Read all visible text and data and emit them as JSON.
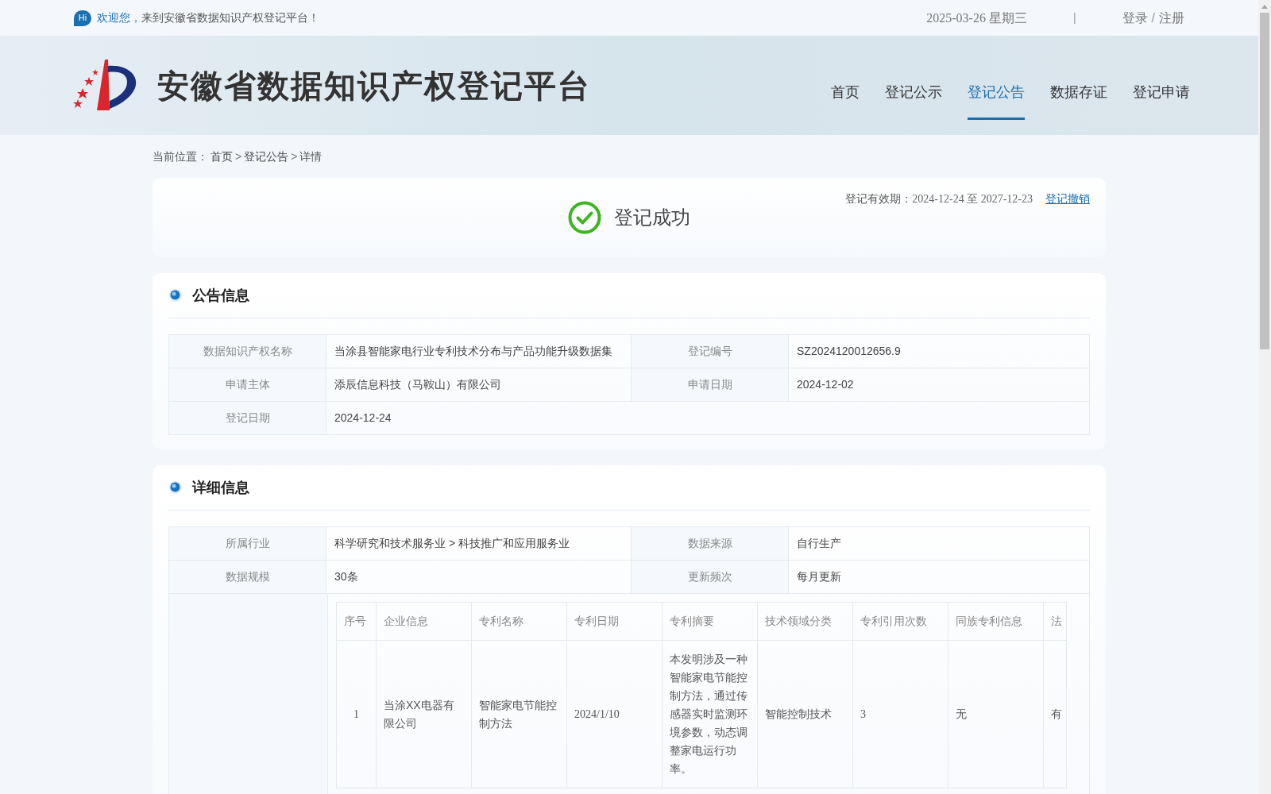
{
  "top_bar": {
    "hi_badge": "Hi",
    "welcome_highlight": "欢迎您，",
    "welcome_text": "来到安徽省数据知识产权登记平台！",
    "date": "2025-03-26 星期三",
    "separator": "|",
    "login": "登录",
    "slash": "/",
    "register": "注册"
  },
  "header": {
    "title": "安徽省数据知识产权登记平台",
    "nav": [
      {
        "label": "首页",
        "selected": false
      },
      {
        "label": "登记公示",
        "selected": false
      },
      {
        "label": "登记公告",
        "selected": true
      },
      {
        "label": "数据存证",
        "selected": false
      },
      {
        "label": "登记申请",
        "selected": false
      }
    ]
  },
  "breadcrumb": {
    "prefix": "当前位置：",
    "items": [
      {
        "kind": "link",
        "text": "首页"
      },
      {
        "kind": "sep",
        "text": ">"
      },
      {
        "kind": "link",
        "text": "登记公告"
      },
      {
        "kind": "sep",
        "text": ">"
      },
      {
        "kind": "current",
        "text": "详情"
      }
    ]
  },
  "status_card": {
    "status": "登记成功",
    "validity_label": "登记有效期：",
    "validity": "2024-12-24 至 2027-12-23",
    "revoke": "登记撤销"
  },
  "sections": [
    {
      "title": "公告信息",
      "rows": [
        [
          {
            "label": "数据知识产权名称",
            "value": "当涂县智能家电行业专利技术分布与产品功能升级数据集"
          },
          {
            "label": "登记编号",
            "value": "SZ2024120012656.9"
          }
        ],
        [
          {
            "label": "申请主体",
            "value": "添辰信息科技（马鞍山）有限公司"
          },
          {
            "label": "申请日期",
            "value": "2024-12-02"
          }
        ],
        [
          {
            "label": "登记日期",
            "value": "2024-12-24"
          }
        ]
      ]
    },
    {
      "title": "详细信息",
      "rows": [
        [
          {
            "label": "所属行业",
            "value": "科学研究和技术服务业 > 科技推广和应用服务业"
          },
          {
            "label": "数据来源",
            "value": "自行生产"
          }
        ],
        [
          {
            "label": "数据规模",
            "value": "30条"
          },
          {
            "label": "更新频次",
            "value": "每月更新"
          }
        ]
      ],
      "sample_table": {
        "columns": [
          "序号",
          "企业信息",
          "专利名称",
          "专利日期",
          "专利摘要",
          "技术领域分类",
          "专利引用次数",
          "同族专利信息",
          "法"
        ],
        "rows": [
          [
            "1",
            "当涂XX电器有限公司",
            "智能家电节能控制方法",
            "2024/1/10",
            "本发明涉及一种智能家电节能控制方法，通过传感器实时监测环境参数，动态调整家电运行功率。",
            "智能控制技术",
            "3",
            "无",
            "有"
          ]
        ]
      }
    }
  ]
}
